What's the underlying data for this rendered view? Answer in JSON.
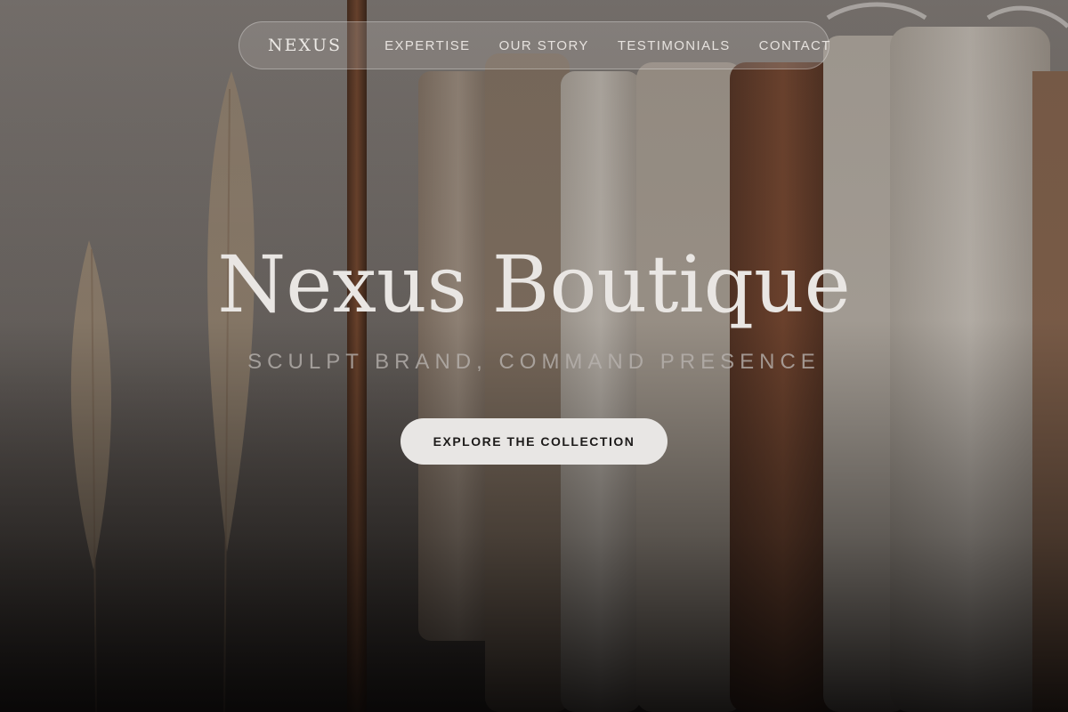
{
  "nav": {
    "brand": "NEXUS",
    "links": [
      "EXPERTISE",
      "OUR STORY",
      "TESTIMONIALS",
      "CONTACT"
    ]
  },
  "hero": {
    "title": "Nexus Boutique",
    "tagline": "SCULPT BRAND, COMMAND PRESENCE",
    "cta_label": "EXPLORE THE COLLECTION",
    "background_image": "clothing-rack-with-pampas-grass"
  },
  "colors": {
    "text_light": "#e9e6e3",
    "button_bg": "#e8e6e4",
    "button_text": "#1d1b1a"
  }
}
